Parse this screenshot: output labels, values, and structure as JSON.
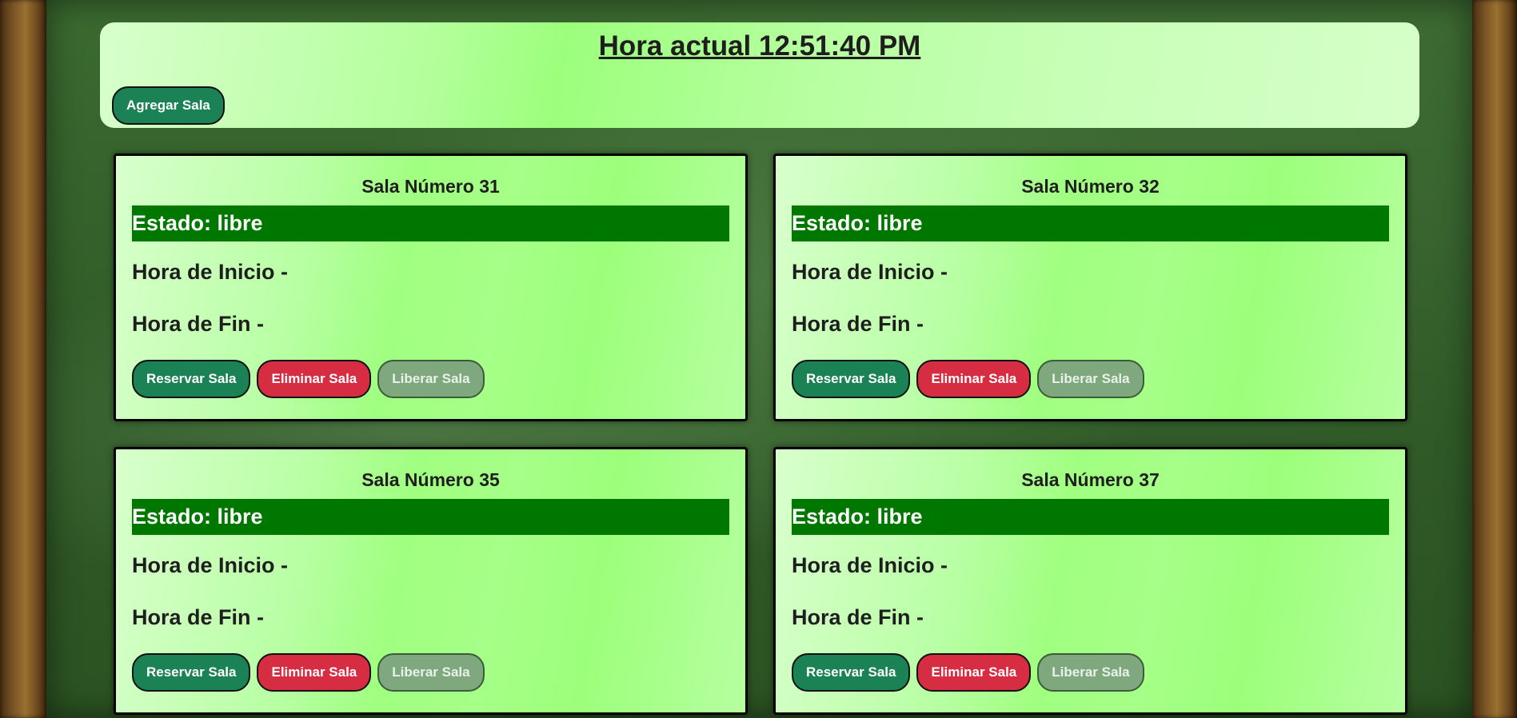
{
  "header": {
    "clock_label": "Hora actual 12:51:40 PM",
    "add_room_label": "Agregar Sala"
  },
  "rooms": [
    {
      "title": "Sala Número 31",
      "status": "Estado: libre",
      "start": "Hora de Inicio -",
      "end": "Hora de Fin -",
      "reserve_label": "Reservar Sala",
      "delete_label": "Eliminar Sala",
      "release_label": "Liberar Sala"
    },
    {
      "title": "Sala Número 32",
      "status": "Estado: libre",
      "start": "Hora de Inicio -",
      "end": "Hora de Fin -",
      "reserve_label": "Reservar Sala",
      "delete_label": "Eliminar Sala",
      "release_label": "Liberar Sala"
    },
    {
      "title": "Sala Número 35",
      "status": "Estado: libre",
      "start": "Hora de Inicio -",
      "end": "Hora de Fin -",
      "reserve_label": "Reservar Sala",
      "delete_label": "Eliminar Sala",
      "release_label": "Liberar Sala"
    },
    {
      "title": "Sala Número 37",
      "status": "Estado: libre",
      "start": "Hora de Inicio -",
      "end": "Hora de Fin -",
      "reserve_label": "Reservar Sala",
      "delete_label": "Eliminar Sala",
      "release_label": "Liberar Sala"
    }
  ],
  "colors": {
    "status_free": "#007800",
    "reserve_button": "#1a8254",
    "delete_button": "#d62d43",
    "release_button_disabled": "#7fa87f"
  }
}
